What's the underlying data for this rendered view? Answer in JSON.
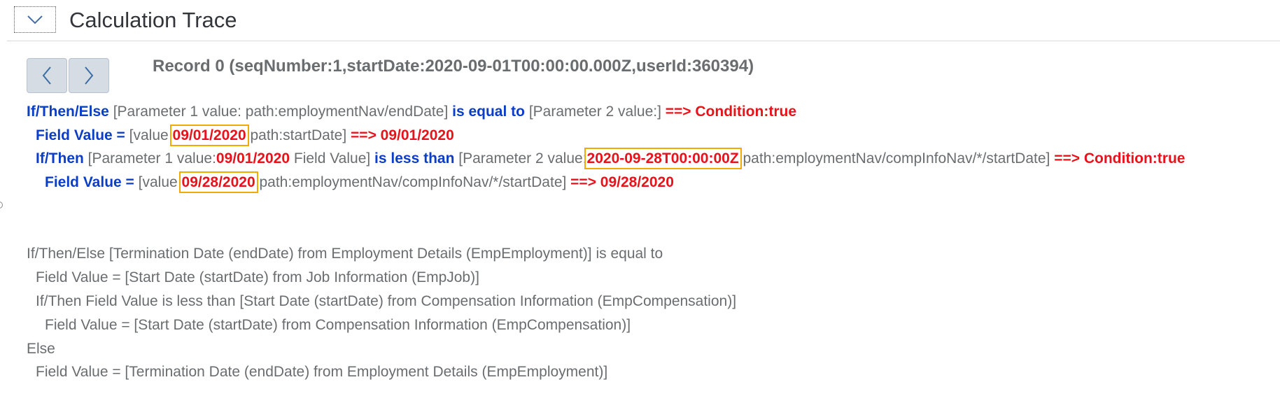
{
  "header": {
    "title": "Calculation Trace",
    "toggle_icon": "chevron-down-icon"
  },
  "nav": {
    "prev_icon": "chevron-left-icon",
    "next_icon": "chevron-right-icon"
  },
  "record": {
    "title": "Record 0 (seqNumber:1,startDate:2020-09-01T00:00:00.000Z,userId:360394)"
  },
  "trace": {
    "line1": {
      "kw": "If/Then/Else",
      "param1": " [Parameter 1 value: path:employmentNav/endDate] ",
      "op": "is equal to",
      "param2": " [Parameter 2 value:] ",
      "result": "==> Condition:true"
    },
    "line2": {
      "kw": "Field Value = ",
      "pre": "[value ",
      "value": "09/01/2020",
      "post": " path:startDate] ",
      "result": "==> 09/01/2020"
    },
    "line3": {
      "kw": "If/Then",
      "pre": " [Parameter 1 value:",
      "value1": "09/01/2020",
      "mid": " Field Value] ",
      "op": "is less than",
      "pre2": " [Parameter 2 value:",
      "value2": "2020-09-28T00:00:00Z",
      "post": " path:employmentNav/compInfoNav/*/startDate] ",
      "result": "==> Condition:true"
    },
    "line4": {
      "kw": "Field Value = ",
      "pre": "[value ",
      "value": "09/28/2020",
      "post": " path:employmentNav/compInfoNav/*/startDate] ",
      "result": "==> 09/28/2020"
    }
  },
  "expression": {
    "lines": [
      "If/Then/Else [Termination Date (endDate) from Employment Details (EmpEmployment)] is equal to",
      "Field Value = [Start Date (startDate) from Job Information (EmpJob)]",
      "If/Then Field Value is less than [Start Date (startDate) from Compensation Information (EmpCompensation)]",
      "Field Value = [Start Date (startDate) from Compensation Information (EmpCompensation)]",
      "Else",
      "Field Value = [Termination Date (endDate) from Employment Details (EmpEmployment)]"
    ]
  },
  "colors": {
    "keyword": "#0b3ec6",
    "result": "#e8131a",
    "highlight": "#f0ab00",
    "text": "#6a6d70"
  }
}
